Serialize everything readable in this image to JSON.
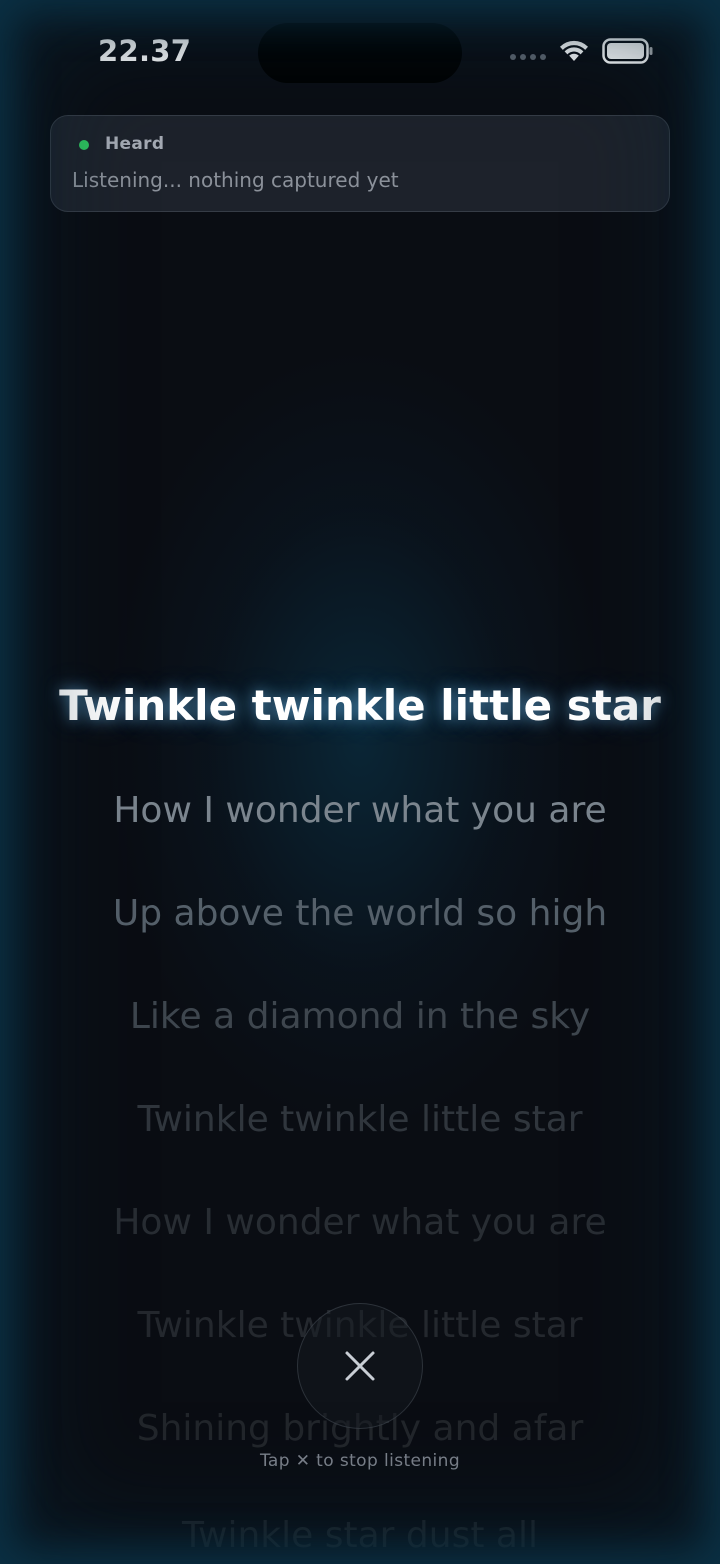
{
  "status_bar": {
    "time": "22.37",
    "icons": [
      "cellular-dots-icon",
      "wifi-icon",
      "battery-icon"
    ]
  },
  "heard_card": {
    "title": "Heard",
    "text": "Listening... nothing captured yet",
    "indicator_color": "#2fc45f"
  },
  "lyrics": [
    {
      "text": "Twinkle twinkle little star",
      "active": true
    },
    {
      "text": "How I wonder what you are",
      "active": false
    },
    {
      "text": "Up above the world so high",
      "active": false
    },
    {
      "text": "Like a diamond in the sky",
      "active": false
    },
    {
      "text": "Twinkle twinkle little star",
      "active": false
    },
    {
      "text": "How I wonder what you are",
      "active": false
    },
    {
      "text": "Twinkle twinkle little star",
      "active": false
    },
    {
      "text": "Shining brightly and afar",
      "active": false
    },
    {
      "text": "Twinkle star dust all",
      "active": false
    }
  ],
  "stop_control": {
    "icon": "close-icon",
    "hint": "Tap ✕ to stop listening"
  },
  "colors": {
    "background": "#0a0d13",
    "accent_glow": "#0b3246",
    "active_lyric": "#ffffff"
  }
}
